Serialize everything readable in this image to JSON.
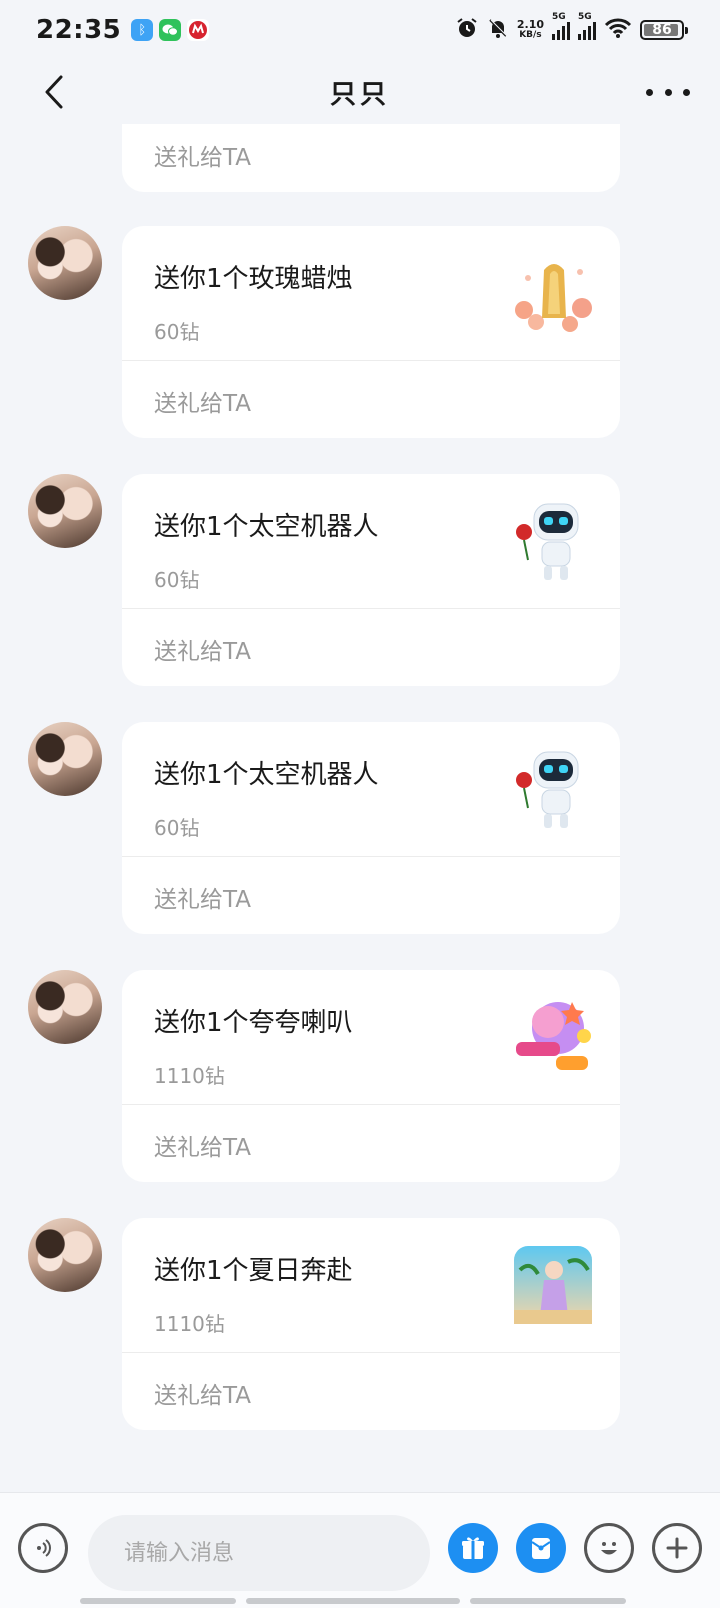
{
  "status_bar": {
    "time": "22:35",
    "net_speed": "2.10",
    "net_unit": "KB/s",
    "sig1": "5G",
    "sig2": "5G",
    "battery": "86",
    "app_icons": [
      "bluetooth-app-icon",
      "wechat-icon",
      "china-merchants-bank-icon"
    ]
  },
  "header": {
    "title": "只只"
  },
  "chat": {
    "partial_card": {
      "send_label": "送礼给TA"
    },
    "messages": [
      {
        "title": "送你1个玫瑰蜡烛",
        "price": "60钻",
        "send_label": "送礼给TA",
        "gift_icon": "rose-candle-gift-icon"
      },
      {
        "title": "送你1个太空机器人",
        "price": "60钻",
        "send_label": "送礼给TA",
        "gift_icon": "space-robot-gift-icon"
      },
      {
        "title": "送你1个太空机器人",
        "price": "60钻",
        "send_label": "送礼给TA",
        "gift_icon": "space-robot-gift-icon"
      },
      {
        "title": "送你1个夸夸喇叭",
        "price": "1110钻",
        "send_label": "送礼给TA",
        "gift_icon": "praise-horn-gift-icon"
      },
      {
        "title": "送你1个夏日奔赴",
        "price": "1110钻",
        "send_label": "送礼给TA",
        "gift_icon": "summer-journey-gift-icon"
      }
    ]
  },
  "bottom_bar": {
    "input_placeholder": "请输入消息",
    "input_value": "",
    "icons": [
      "voice-icon",
      "gift-icon",
      "red-packet-icon",
      "emoji-icon",
      "plus-icon"
    ],
    "accent": "#1d8ff2"
  }
}
